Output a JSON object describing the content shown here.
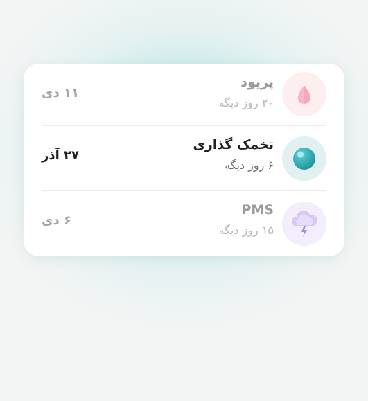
{
  "events": [
    {
      "title": "پریود",
      "subtitle": "۲۰ روز دیگه",
      "date": "۱۱ دی",
      "icon": "drop-icon",
      "accent": "#f4a3b8"
    },
    {
      "title": "تخمک گذاری",
      "subtitle": "۶ روز دیگه",
      "date": "۲۷ آذر",
      "icon": "egg-icon",
      "accent": "#2aa3ad"
    },
    {
      "title": "PMS",
      "subtitle": "۱۵ روز دیگه",
      "date": "۶ دی",
      "icon": "storm-cloud-icon",
      "accent": "#c9b4ef"
    }
  ]
}
